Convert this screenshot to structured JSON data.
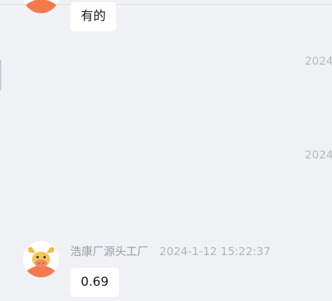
{
  "messages": [
    {
      "text": "有的",
      "avatar": "bull-avatar-icon"
    },
    {
      "sender": "浩康厂源头工厂",
      "time": "2024-1-12 15:22:37",
      "text": "0.69",
      "avatar": "bull-avatar-icon"
    }
  ],
  "clipped_timestamps": [
    "2024",
    "2024"
  ],
  "colors": {
    "background": "#f0f1f5",
    "bubble": "#ffffff",
    "avatar_body": "#f47a4c",
    "avatar_horns": "#f5b73d"
  }
}
